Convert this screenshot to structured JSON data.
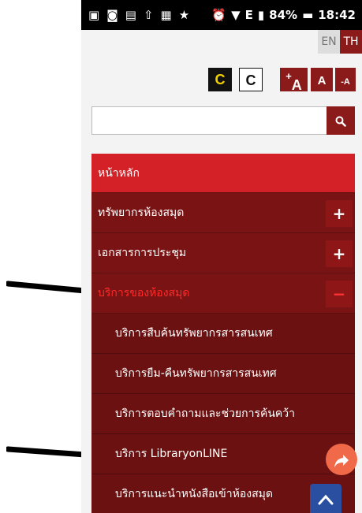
{
  "status_bar": {
    "battery": "84%",
    "time": "18:42",
    "network": "E"
  },
  "language": {
    "en": "EN",
    "th": "TH"
  },
  "accessibility": {
    "contrast_dark": "C",
    "contrast_light": "C",
    "font_increase": "A",
    "font_increase_sign": "+",
    "font_normal": "A",
    "font_decrease": "A",
    "font_decrease_sign": "-"
  },
  "search": {
    "placeholder": "",
    "value": ""
  },
  "menu": {
    "home": "หน้าหลัก",
    "items": [
      {
        "label": "ทรัพยากรห้องสมุด",
        "toggle": "+"
      },
      {
        "label": "เอกสารการประชุม",
        "toggle": "+"
      },
      {
        "label": "บริการของห้องสมุด",
        "toggle": "−"
      }
    ],
    "sub_items": [
      "บริการสืบค้นทรัพยากรสารสนเทศ",
      "บริการยืม-คืนทรัพยากรสารสนเทศ",
      "บริการตอบคำถามและช่วยการค้นคว้า",
      "บริการ LibraryonLINE",
      "บริการแนะนำหนังสือเข้าห้องสมุด"
    ]
  },
  "colors": {
    "accent": "#8b1a1a",
    "home": "#d42027",
    "menu_bg": "#7a1414",
    "active_text": "#ff2a2a"
  }
}
